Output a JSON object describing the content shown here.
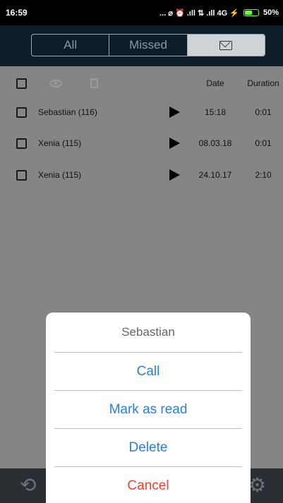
{
  "status": {
    "time": "16:59",
    "indicators": "... ⌀ ⏰ .ıll ⇅ .ıll 4G ⚡",
    "battery": "50%"
  },
  "tabs": [
    {
      "label": "All"
    },
    {
      "label": "Missed"
    },
    {
      "label": "",
      "icon": "envelope-icon",
      "active": true
    }
  ],
  "list": {
    "header": {
      "date": "Date",
      "duration": "Duration"
    },
    "rows": [
      {
        "name": "Sebastian (116)",
        "date": "15:18",
        "duration": "0:01"
      },
      {
        "name": "Xenia (115)",
        "date": "08.03.18",
        "duration": "0:01"
      },
      {
        "name": "Xenia (115)",
        "date": "24.10.17",
        "duration": "2:10"
      }
    ]
  },
  "dialog": {
    "title": "Sebastian",
    "call": "Call",
    "mark_read": "Mark as read",
    "delete": "Delete",
    "cancel": "Cancel"
  },
  "colors": {
    "action": "#2a7fd6",
    "cancel": "#e8442e",
    "tab_bar": "#0f1d29"
  }
}
